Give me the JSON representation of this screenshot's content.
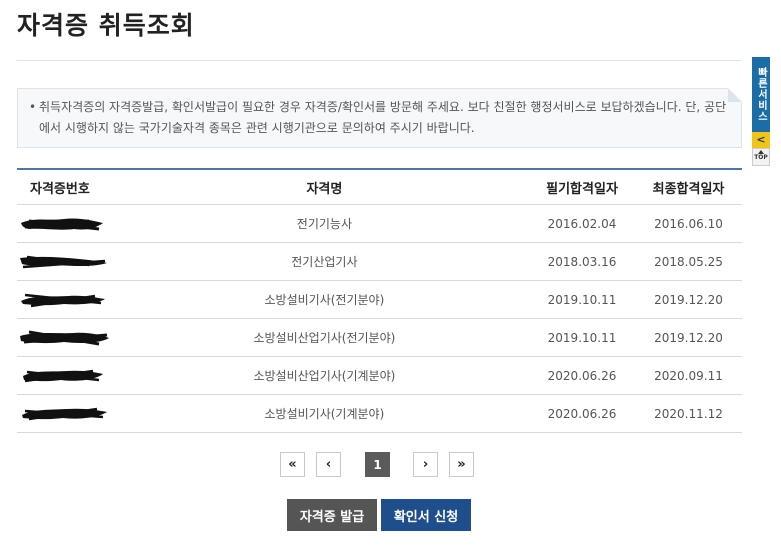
{
  "page": {
    "title": "자격증 취득조회"
  },
  "notice": {
    "bullet": "•",
    "text": "취득자격증의 자격증발급, 확인서발급이 필요한 경우 자격증/확인서를 방문해 주세요. 보다 친절한 행정서비스로 보답하겠습니다. 단, 공단에서 시행하지 않는 국가기술자격 종목은 관련 시행기관으로 문의하여 주시기 바랍니다."
  },
  "quick_menu": {
    "label": "빠른서비스",
    "arrow": "<",
    "top": "TOP"
  },
  "table": {
    "headers": {
      "number": "자격증번호",
      "name": "자격명",
      "written_pass": "필기합격일자",
      "final_pass": "최종합격일자"
    },
    "rows": [
      {
        "name": "전기기능사",
        "written_pass": "2016.02.04",
        "final_pass": "2016.06.10"
      },
      {
        "name": "전기산업기사",
        "written_pass": "2018.03.16",
        "final_pass": "2018.05.25"
      },
      {
        "name": "소방설비기사(전기분야)",
        "written_pass": "2019.10.11",
        "final_pass": "2019.12.20"
      },
      {
        "name": "소방설비산업기사(전기분야)",
        "written_pass": "2019.10.11",
        "final_pass": "2019.12.20"
      },
      {
        "name": "소방설비산업기사(기계분야)",
        "written_pass": "2020.06.26",
        "final_pass": "2020.09.11"
      },
      {
        "name": "소방설비기사(기계분야)",
        "written_pass": "2020.06.26",
        "final_pass": "2020.11.12"
      }
    ]
  },
  "pagination": {
    "first": "«",
    "prev": "‹",
    "current": "1",
    "next": "›",
    "last": "»"
  },
  "buttons": {
    "issue_cert": "자격증 발급",
    "request_confirm": "확인서 신청"
  }
}
